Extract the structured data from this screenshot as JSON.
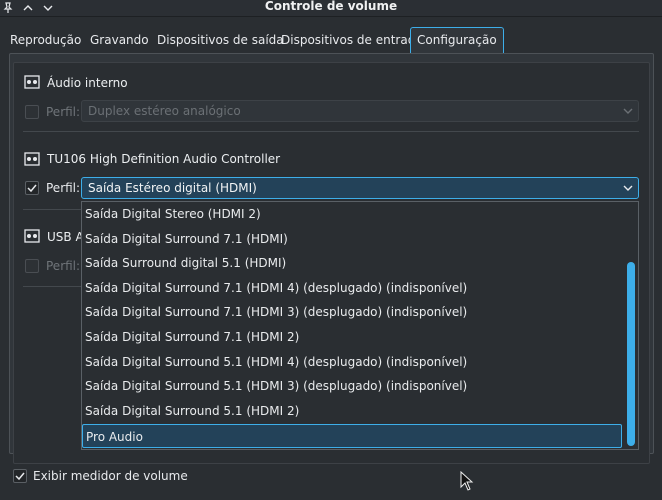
{
  "window": {
    "title": "Controle de volume",
    "icons": [
      "pin-icon",
      "chevron-up-icon",
      "chevron-down-icon"
    ]
  },
  "tabs": [
    {
      "label": "Reprodução",
      "active": false
    },
    {
      "label": "Gravando",
      "active": false
    },
    {
      "label": "Dispositivos de saída",
      "active": false
    },
    {
      "label": "Dispositivos de entrada",
      "active": false
    },
    {
      "label": "Configuração",
      "active": true
    }
  ],
  "cards": [
    {
      "name": "Áudio interno",
      "icon": "audio-card-icon",
      "profile_label": "Perfil:",
      "profile_value": "Duplex estéreo analógico",
      "enabled": false
    },
    {
      "name": "TU106 High Definition Audio Controller",
      "icon": "audio-card-icon",
      "profile_label": "Perfil:",
      "profile_value": "Saída Estéreo digital (HDMI)",
      "enabled": true
    },
    {
      "name": "USB Au",
      "icon": "audio-card-icon",
      "profile_label": "Perfil:",
      "enabled": false
    }
  ],
  "dropdown": {
    "items": [
      "Saída Digital Stereo (HDMI 2)",
      "Saída Digital Surround 7.1 (HDMI)",
      "Saída Surround digital 5.1 (HDMI)",
      "Saída Digital Surround 7.1 (HDMI 4) (desplugado) (indisponível)",
      "Saída Digital Surround 7.1 (HDMI 3) (desplugado) (indisponível)",
      "Saída Digital Surround 7.1 (HDMI 2)",
      "Saída Digital Surround 5.1 (HDMI 4) (desplugado) (indisponível)",
      "Saída Digital Surround 5.1 (HDMI 3) (desplugado) (indisponível)",
      "Saída Digital Surround 5.1 (HDMI 2)",
      "Pro Audio"
    ],
    "selected_index": 9
  },
  "footer": {
    "show_meter_label": "Exibir medidor de volume",
    "show_meter_checked": true
  },
  "colors": {
    "accent": "#3daee9",
    "background": "#2a2e32",
    "selection": "#234259"
  }
}
